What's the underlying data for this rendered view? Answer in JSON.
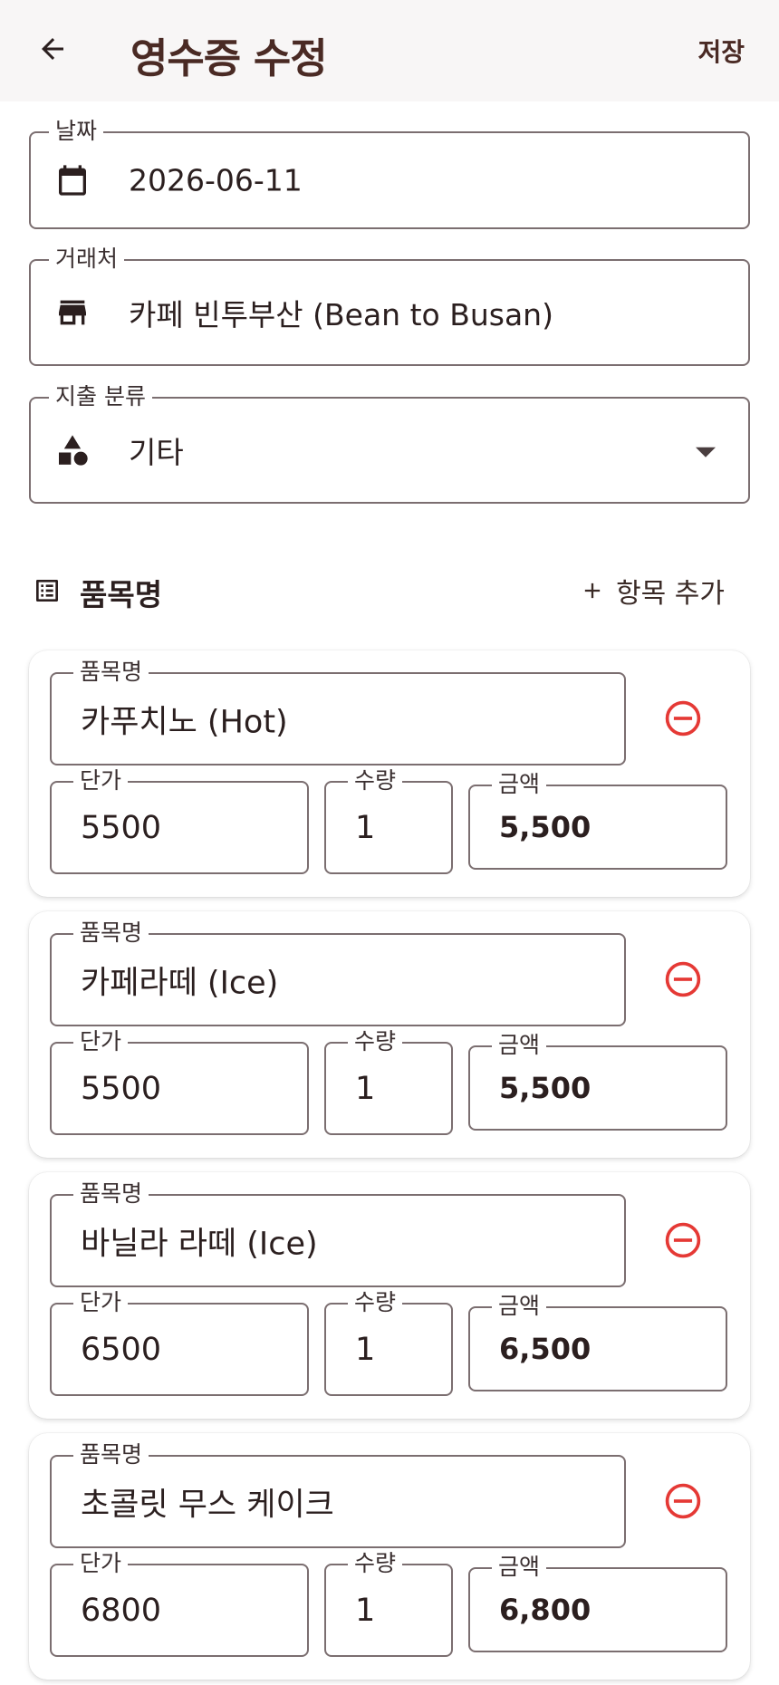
{
  "appbar": {
    "title": "영수증 수정",
    "save_label": "저장",
    "back_icon": "arrow-back-icon"
  },
  "form": {
    "date": {
      "label": "날짜",
      "value": "2026-06-11",
      "icon": "calendar-icon"
    },
    "merchant": {
      "label": "거래처",
      "value": "카페 빈투부산 (Bean to Busan)",
      "icon": "store-icon"
    },
    "category": {
      "label": "지출 분류",
      "value": "기타",
      "icon": "category-shapes-icon"
    }
  },
  "items_section": {
    "title": "품목명",
    "add_label": "항목 추가",
    "icon": "list-icon"
  },
  "items": [
    {
      "name_label": "품목명",
      "name": "카푸치노 (Hot)",
      "price_label": "단가",
      "price": "5500",
      "qty_label": "수량",
      "qty": "1",
      "amount_label": "금액",
      "amount": "5,500"
    },
    {
      "name_label": "품목명",
      "name": "카페라떼 (Ice)",
      "price_label": "단가",
      "price": "5500",
      "qty_label": "수량",
      "qty": "1",
      "amount_label": "금액",
      "amount": "5,500"
    },
    {
      "name_label": "품목명",
      "name": "바닐라 라떼 (Ice)",
      "price_label": "단가",
      "price": "6500",
      "qty_label": "수량",
      "qty": "1",
      "amount_label": "금액",
      "amount": "6,500"
    },
    {
      "name_label": "품목명",
      "name": "초콜릿 무스 케이크",
      "price_label": "단가",
      "price": "6800",
      "qty_label": "수량",
      "qty": "1",
      "amount_label": "금액",
      "amount": "6,800"
    }
  ],
  "colors": {
    "accent": "#4a2a24",
    "remove": "#e53935",
    "outline": "#7b6e70"
  }
}
